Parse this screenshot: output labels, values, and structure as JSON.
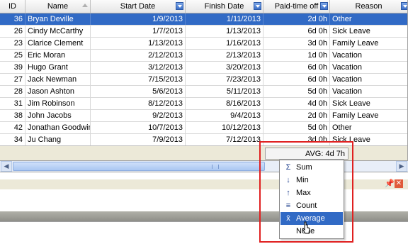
{
  "grid": {
    "columns": [
      {
        "key": "id",
        "label": "ID"
      },
      {
        "key": "name",
        "label": "Name"
      },
      {
        "key": "start",
        "label": "Start Date"
      },
      {
        "key": "finish",
        "label": "Finish Date"
      },
      {
        "key": "pto",
        "label": "Paid-time off"
      },
      {
        "key": "reason",
        "label": "Reason"
      }
    ],
    "rows": [
      {
        "id": "36",
        "name": "Bryan Deville",
        "start": "1/9/2013",
        "finish": "1/11/2013",
        "pto": "2d 0h",
        "reason": "Other",
        "selected": true
      },
      {
        "id": "26",
        "name": "Cindy McCarthy",
        "start": "1/7/2013",
        "finish": "1/13/2013",
        "pto": "6d 0h",
        "reason": "Sick Leave"
      },
      {
        "id": "23",
        "name": "Clarice Clement",
        "start": "1/13/2013",
        "finish": "1/16/2013",
        "pto": "3d 0h",
        "reason": "Family Leave"
      },
      {
        "id": "25",
        "name": "Eric Moran",
        "start": "2/12/2013",
        "finish": "2/13/2013",
        "pto": "1d 0h",
        "reason": "Vacation"
      },
      {
        "id": "39",
        "name": "Hugo Grant",
        "start": "3/12/2013",
        "finish": "3/20/2013",
        "pto": "6d 0h",
        "reason": "Vacation"
      },
      {
        "id": "27",
        "name": "Jack Newman",
        "start": "7/15/2013",
        "finish": "7/23/2013",
        "pto": "6d 0h",
        "reason": "Vacation"
      },
      {
        "id": "28",
        "name": "Jason Ashton",
        "start": "5/6/2013",
        "finish": "5/11/2013",
        "pto": "5d 0h",
        "reason": "Vacation"
      },
      {
        "id": "31",
        "name": "Jim Robinson",
        "start": "8/12/2013",
        "finish": "8/16/2013",
        "pto": "4d 0h",
        "reason": "Sick Leave"
      },
      {
        "id": "38",
        "name": "John Jacobs",
        "start": "9/2/2013",
        "finish": "9/4/2013",
        "pto": "2d 0h",
        "reason": "Family Leave"
      },
      {
        "id": "42",
        "name": "Jonathan Goodwin",
        "start": "10/7/2013",
        "finish": "10/12/2013",
        "pto": "5d 0h",
        "reason": "Other"
      },
      {
        "id": "34",
        "name": "Ju Chang",
        "start": "7/9/2013",
        "finish": "7/12/2013",
        "pto": "3d 0h",
        "reason": "Sick Leave"
      }
    ],
    "footer_summary": "AVG: 4d 7h"
  },
  "summary_menu": {
    "items": [
      {
        "label": "Sum",
        "icon": "sigma-icon",
        "glyph": "Σ"
      },
      {
        "label": "Min",
        "icon": "min-icon",
        "glyph": "↓"
      },
      {
        "label": "Max",
        "icon": "max-icon",
        "glyph": "↑"
      },
      {
        "label": "Count",
        "icon": "count-icon",
        "glyph": "≡"
      },
      {
        "label": "Average",
        "icon": "average-icon",
        "glyph": "x̄",
        "highlighted": true
      },
      {
        "label": "None",
        "icon": "",
        "glyph": ""
      }
    ]
  },
  "colors": {
    "selection": "#316ac5",
    "annotation": "#e02020"
  }
}
